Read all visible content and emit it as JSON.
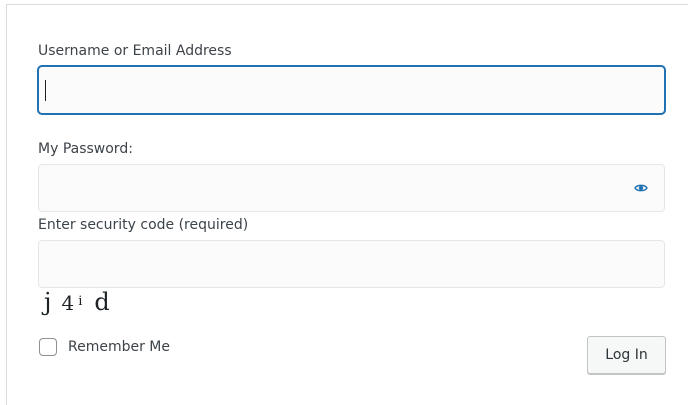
{
  "form": {
    "username_label": "Username or Email Address",
    "username_value": "",
    "password_label": "My Password:",
    "password_value": "",
    "security_label": "Enter security code (required)",
    "security_value": "",
    "captcha_chars": [
      "j",
      "4",
      "i",
      "d"
    ],
    "remember_label": "Remember Me",
    "remember_checked": false,
    "login_label": "Log In",
    "show_password_icon": "eye-icon",
    "accent_color": "#2271b1"
  }
}
